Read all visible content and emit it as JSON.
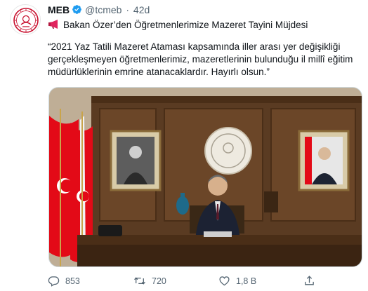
{
  "tweet": {
    "author_name": "MEB",
    "handle": "@tcmeb",
    "separator": "·",
    "time": "42d",
    "headline": "Bakan Özer’den Öğretmenlerimize Mazeret Tayini Müjdesi",
    "quote_lines": [
      "“2021 Yaz Tatili Mazeret Ataması kapsamında iller arası yer değişikliği",
      "gerçekleşmeyen öğretmenlerimiz, mazeretlerinin bulunduğu il millî eğitim",
      "müdürlüklerinin emrine atanacaklardır. Hayırlı olsun.”"
    ]
  },
  "icons": {
    "verified": "verified-badge-icon",
    "megaphone": "megaphone-icon",
    "reply": "reply-icon",
    "retweet": "retweet-icon",
    "like": "heart-icon",
    "share": "share-icon"
  },
  "actions": {
    "replies": "853",
    "retweets": "720",
    "likes": "1,8 B"
  },
  "colors": {
    "verified": "#1d9bf0",
    "text": "#0f1419",
    "muted": "#536471",
    "flag_red": "#e30a17",
    "logo_red": "#c8102e"
  }
}
